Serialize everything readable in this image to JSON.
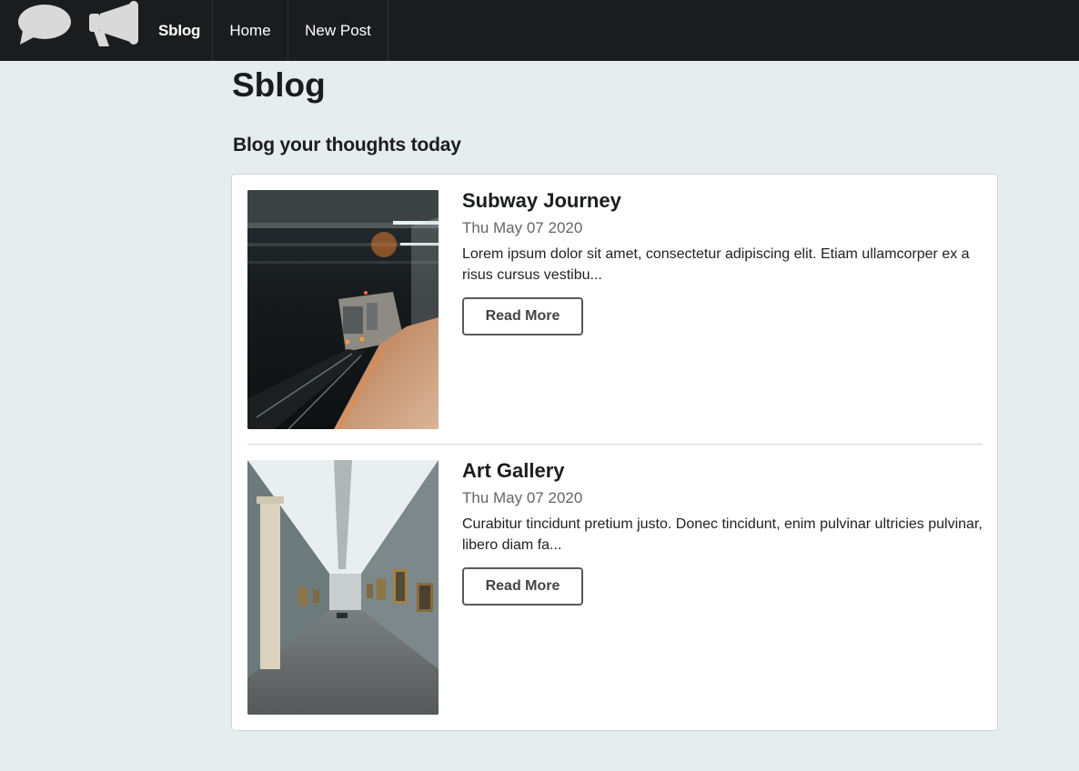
{
  "nav": {
    "brand": "Sblog",
    "links": [
      {
        "label": "Home"
      },
      {
        "label": "New Post"
      }
    ],
    "icons": [
      "chat-bubble-icon",
      "megaphone-icon"
    ]
  },
  "header": {
    "title": "Sblog",
    "subtitle": "Blog your thoughts today"
  },
  "posts": [
    {
      "title": "Subway Journey",
      "date": "Thu May 07 2020",
      "excerpt": "Lorem ipsum dolor sit amet, consectetur adipiscing elit. Etiam ullamcorper ex a risus cursus vestibu...",
      "button": "Read More"
    },
    {
      "title": "Art Gallery",
      "date": "Thu May 07 2020",
      "excerpt": "Curabitur tincidunt pretium justo. Donec tincidunt, enim pulvinar ultricies pulvinar, libero diam fa...",
      "button": "Read More"
    }
  ],
  "colors": {
    "navbar": "#1b1c1d",
    "page_background": "#e6edef",
    "card_background": "#ffffff"
  }
}
